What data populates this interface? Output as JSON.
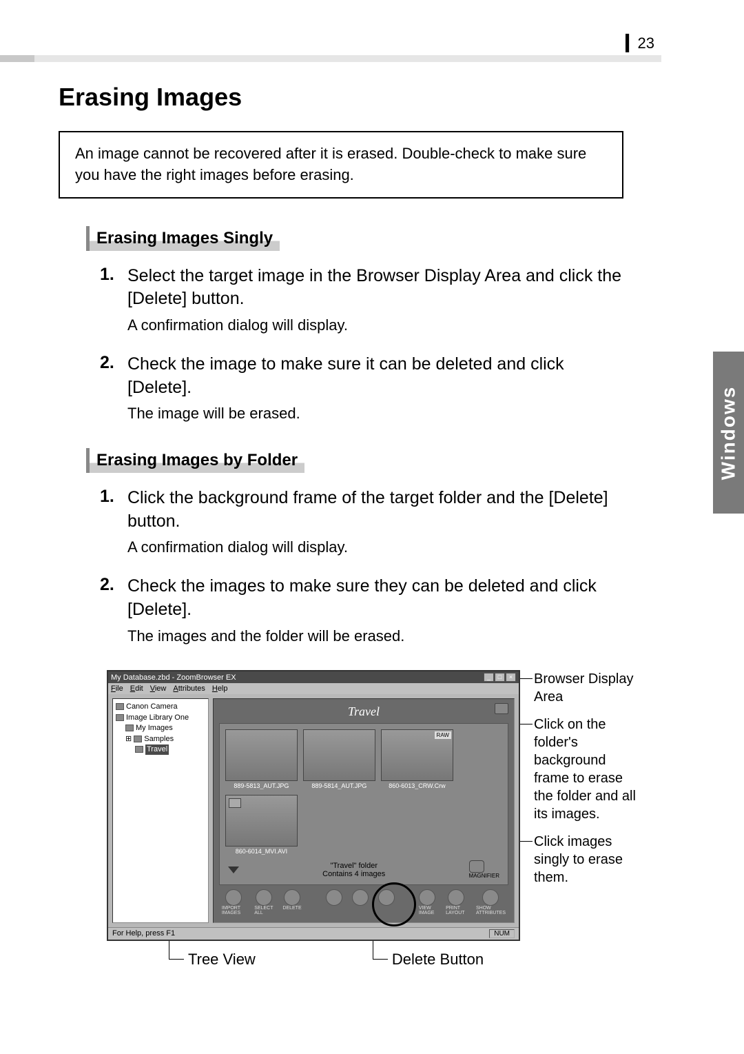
{
  "page_number": "23",
  "heading": "Erasing Images",
  "warning": "An image cannot be recovered after it is erased. Double-check to make sure you have the right images before erasing.",
  "side_tab": "Windows",
  "section_singly": {
    "title": "Erasing Images Singly",
    "step1_num": "1.",
    "step1": "Select the target image in the Browser Display Area and click the [Delete] button.",
    "step1_note": "A confirmation dialog will display.",
    "step2_num": "2.",
    "step2": "Check the image to make sure it can be deleted and click [Delete].",
    "step2_note": "The image will be erased."
  },
  "section_folder": {
    "title": "Erasing Images by Folder",
    "step1_num": "1.",
    "step1": "Click the background frame of the target folder and the [Delete] button.",
    "step1_note": "A confirmation dialog will display.",
    "step2_num": "2.",
    "step2": "Check the images to make sure they can be deleted and click [Delete].",
    "step2_note": "The images and the folder will be erased."
  },
  "screenshot": {
    "title": "My Database.zbd - ZoomBrowser EX",
    "menu": {
      "file": "File",
      "edit": "Edit",
      "view": "View",
      "attributes": "Attributes",
      "help": "Help"
    },
    "tree": {
      "camera": "Canon Camera",
      "library": "Image Library One",
      "myimages": "My Images",
      "samples": "Samples",
      "travel": "Travel"
    },
    "folder_title": "Travel",
    "thumbs": {
      "t1": "889-5813_AUT.JPG",
      "t2": "889-5814_AUT.JPG",
      "t3": "860-6013_CRW.Crw",
      "t4": "860-6014_MVI.AVI",
      "raw_badge": "RAW"
    },
    "folder_info_1": "\"Travel\" folder",
    "folder_info_2": "Contains 4 images",
    "magnifier_label": "MAGNIFIER",
    "toolbar": {
      "import": "IMPORT IMAGES",
      "select": "SELECT ALL",
      "delete": "DELETE",
      "view": "VIEW IMAGE",
      "print": "PRINT LAYOUT",
      "show": "SHOW ATTRIBUTES"
    },
    "status_left": "For Help, press F1",
    "status_right": "NUM"
  },
  "annotations": {
    "a1": "Browser Display Area",
    "a2": "Click on the folder's background frame to erase the folder and all its images.",
    "a3": "Click images singly to erase them."
  },
  "bottom_labels": {
    "treeview": "Tree View",
    "deletebtn": "Delete Button"
  }
}
